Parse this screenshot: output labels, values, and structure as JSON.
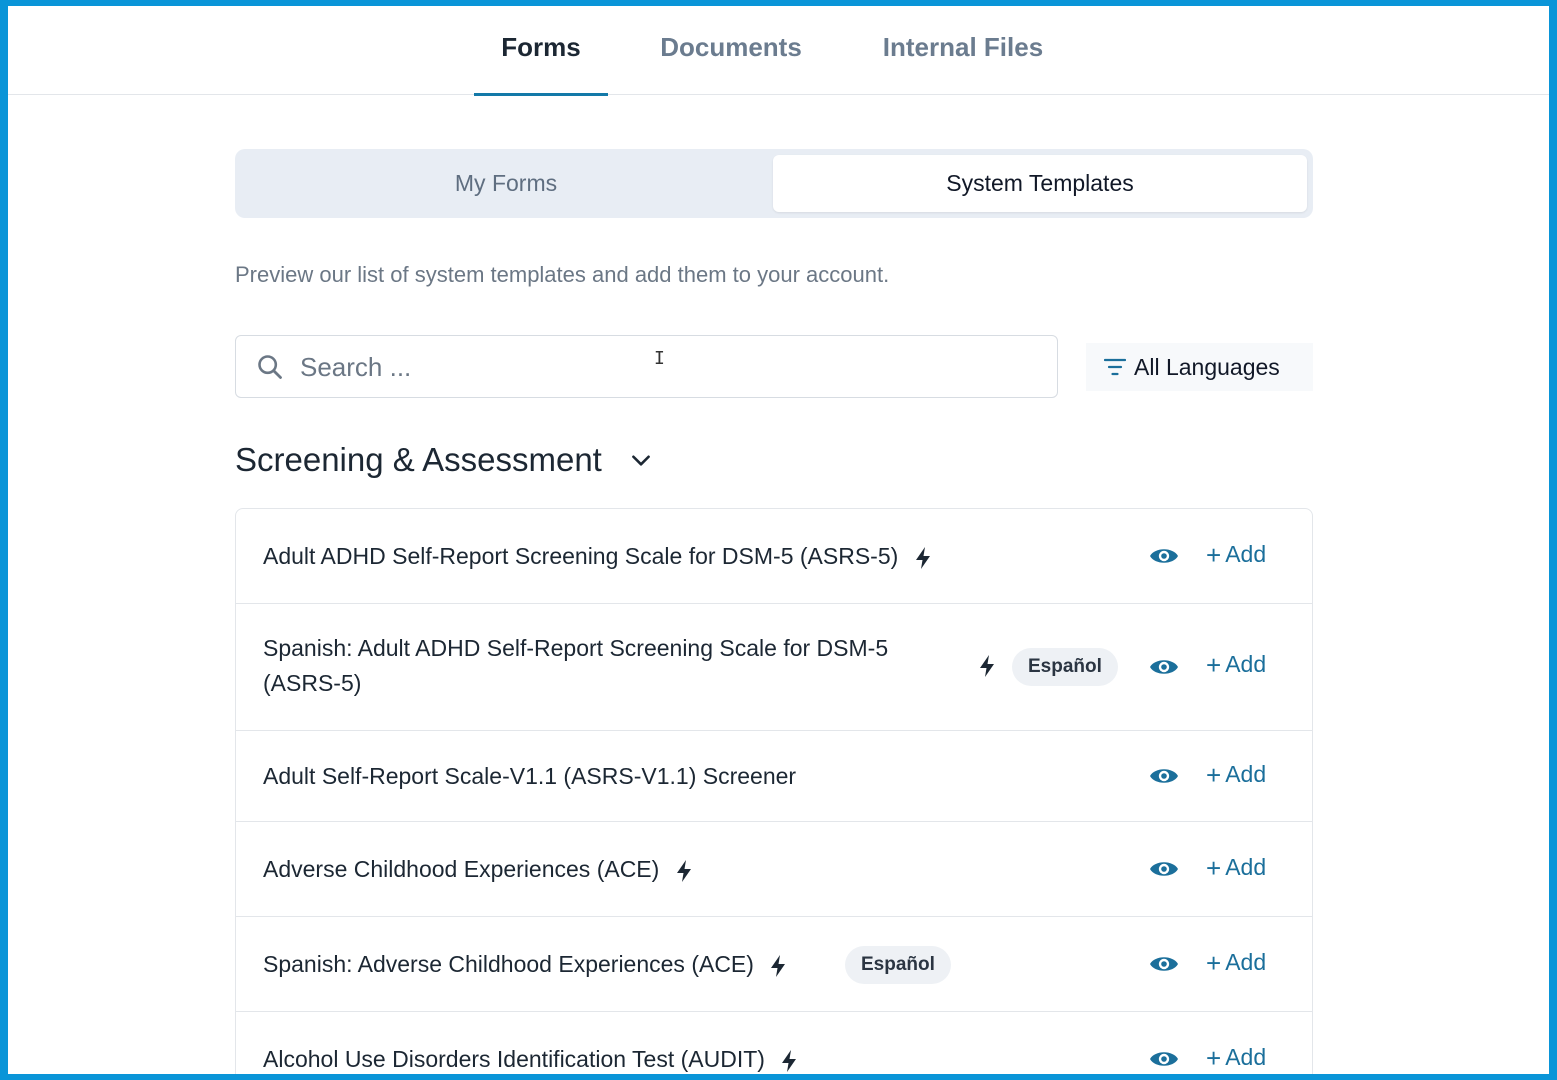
{
  "tabs": [
    {
      "label": "Forms",
      "active": true
    },
    {
      "label": "Documents",
      "active": false
    },
    {
      "label": "Internal Files",
      "active": false
    }
  ],
  "segmented": {
    "my_forms": "My Forms",
    "system_templates": "System Templates",
    "selected": "System Templates"
  },
  "intro_text": "Preview our list of system templates and add them to your account.",
  "search": {
    "placeholder": "Search ...",
    "value": ""
  },
  "language_filter": {
    "label": "All Languages"
  },
  "section": {
    "title": "Screening & Assessment",
    "expanded": true
  },
  "actions": {
    "add_label": "Add",
    "plus": "+"
  },
  "rows": [
    {
      "title": "Adult ADHD Self-Report Screening Scale for DSM-5 (ASRS-5)",
      "bolt": true,
      "badge": ""
    },
    {
      "title_line1": "Spanish: Adult ADHD Self-Report Screening Scale for DSM-5",
      "title_line2": "(ASRS-5)",
      "bolt": true,
      "badge": "Español"
    },
    {
      "title": "Adult Self-Report Scale-V1.1 (ASRS-V1.1) Screener",
      "bolt": false,
      "badge": ""
    },
    {
      "title": "Adverse Childhood Experiences (ACE)",
      "bolt": true,
      "badge": ""
    },
    {
      "title": "Spanish: Adverse Childhood Experiences (ACE)",
      "bolt": true,
      "badge": "Español"
    },
    {
      "title": "Alcohol Use Disorders Identification Test (AUDIT)",
      "bolt": true,
      "badge": ""
    }
  ],
  "colors": {
    "accent": "#1379a8",
    "link": "#1b6f9b",
    "frame": "#0a95d8"
  }
}
